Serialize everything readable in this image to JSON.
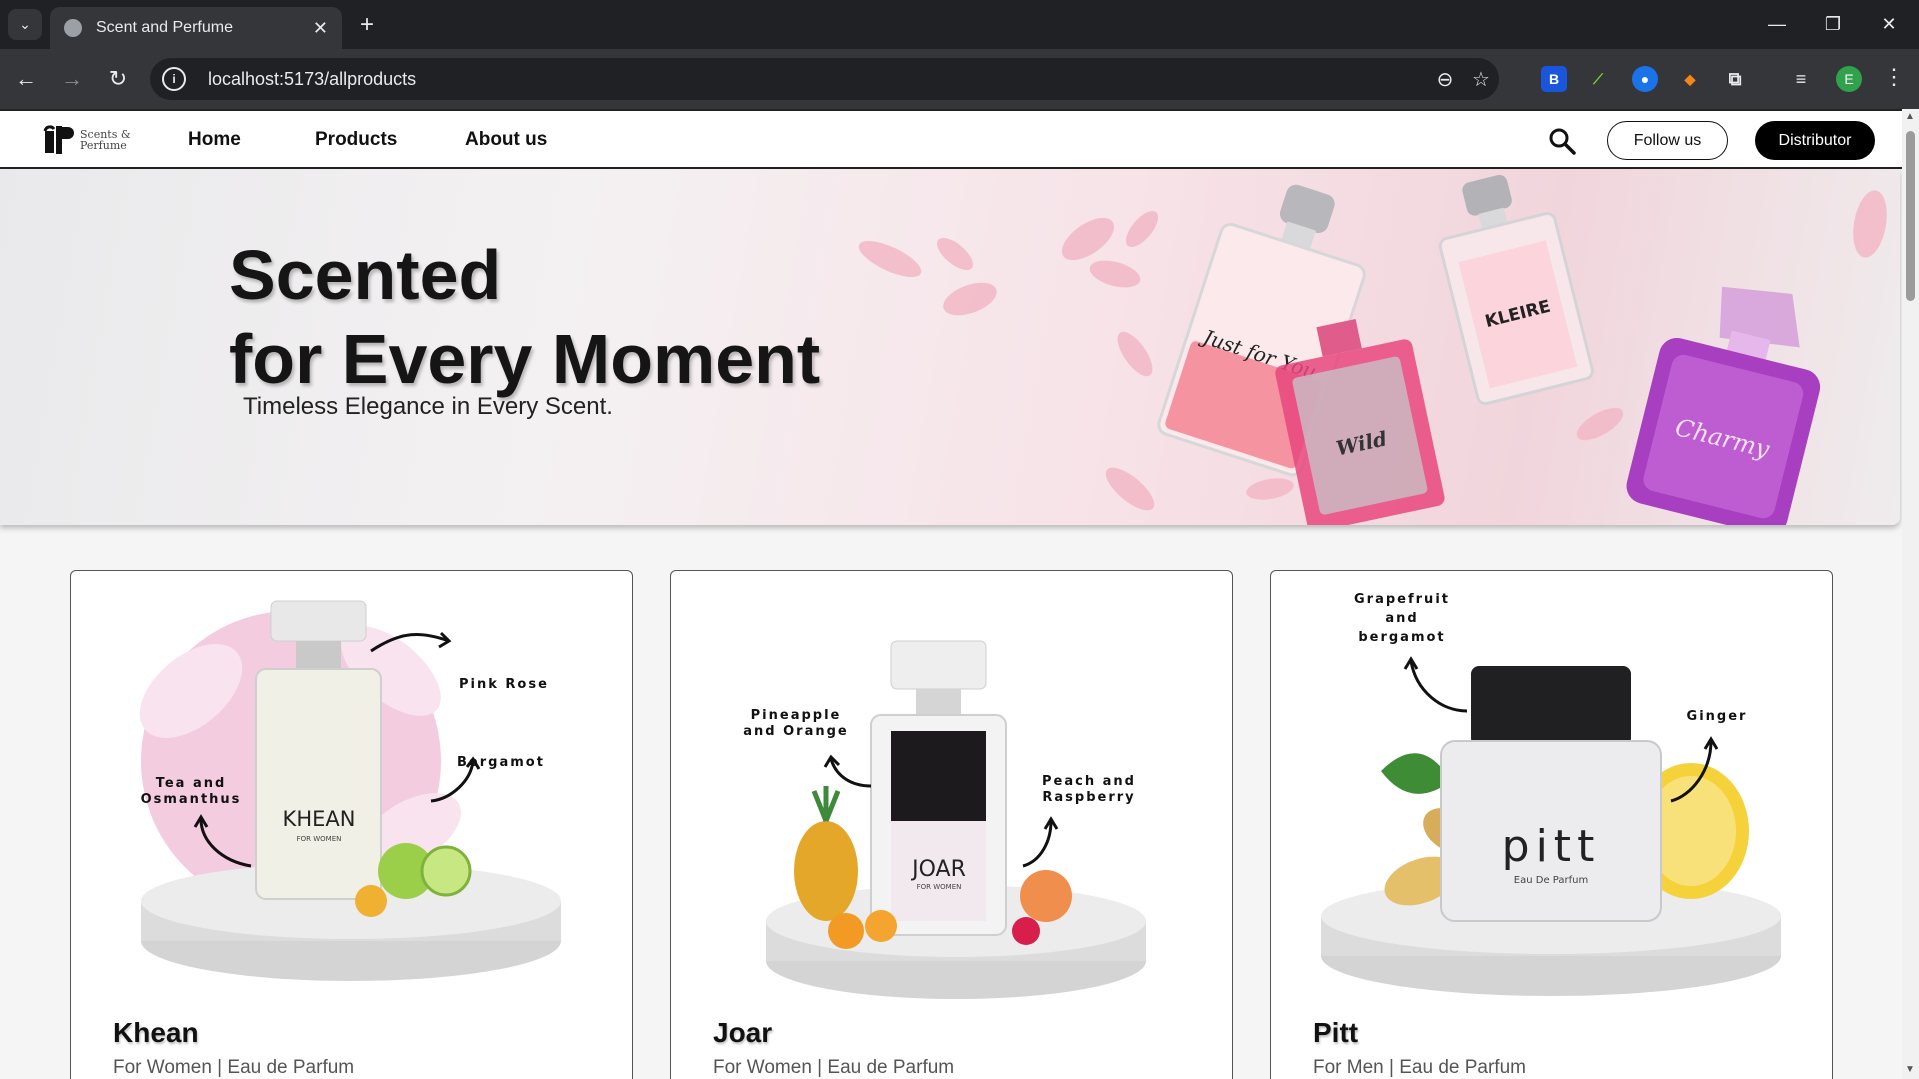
{
  "browser": {
    "tab_title": "Scent and Perfume",
    "url": "localhost:5173/allproducts",
    "profile_initial": "E"
  },
  "nav": {
    "logo_text_1": "Scents &",
    "logo_text_2": "Perfume",
    "links": [
      "Home",
      "Products",
      "About us"
    ],
    "follow_label": "Follow us",
    "distributor_label": "Distributor"
  },
  "hero": {
    "title_line1": "Scented",
    "title_line2": "for Every Moment",
    "subtitle": "Timeless Elegance in Every Scent.",
    "bottle_labels": [
      "Just for You",
      "Wild",
      "KLEIRE",
      "Charmy"
    ]
  },
  "products": [
    {
      "name": "Khean",
      "meta": "For Women | Eau de Parfum",
      "bottle_label": "KHEAN",
      "bottle_sub": "FOR WOMEN",
      "notes": [
        "Pink Rose",
        "Bergamot",
        "Tea and",
        "Osmanthus"
      ]
    },
    {
      "name": "Joar",
      "meta": "For Women | Eau de Parfum",
      "bottle_label": "JOAR",
      "bottle_sub": "FOR WOMEN",
      "notes": [
        "Pineapple",
        "and Orange",
        "Peach and",
        "Raspberry"
      ]
    },
    {
      "name": "Pitt",
      "meta": "For Men | Eau de Parfum",
      "bottle_label": "pitt",
      "bottle_sub": "Eau De Parfum",
      "notes": [
        "Grapefruit",
        "and",
        "bergamot",
        "Ginger"
      ]
    }
  ],
  "colors": {
    "hero_pink": "#f1d5dc",
    "accent_black": "#000000",
    "card_border": "#555555"
  }
}
